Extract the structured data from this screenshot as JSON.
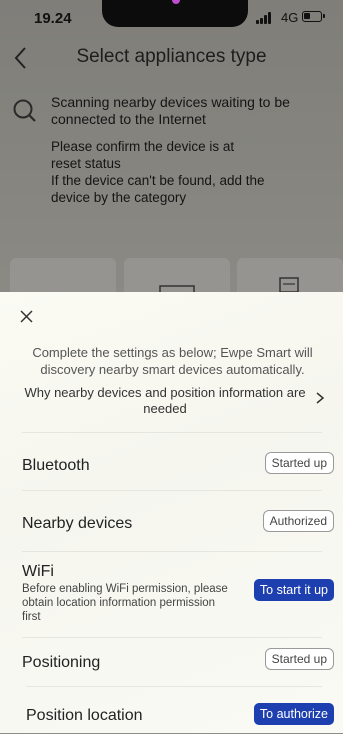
{
  "status_bar": {
    "time": "19.24",
    "network": "4G"
  },
  "nav": {
    "title": "Select appliances type"
  },
  "scan": {
    "text": "Scanning nearby devices waiting to be connected to the Internet",
    "confirm": "Please confirm the device is at\nreset status\n If the device can't be found, add the\ndevice by the category"
  },
  "sheet": {
    "intro": "Complete the settings as below; Ewpe Smart will discovery nearby smart devices automatically.",
    "why": "Why nearby devices and position information are needed",
    "rows": [
      {
        "label": "Bluetooth",
        "action": "Started up"
      },
      {
        "label": "Nearby devices",
        "action": "Authorized"
      },
      {
        "label": "WiFi",
        "sub": "Before enabling WiFi permission, please obtain location information permission first",
        "action": "To start it up"
      },
      {
        "label": "Positioning",
        "action": "Started up"
      },
      {
        "label": "Position location",
        "action": "To authorize"
      }
    ]
  }
}
